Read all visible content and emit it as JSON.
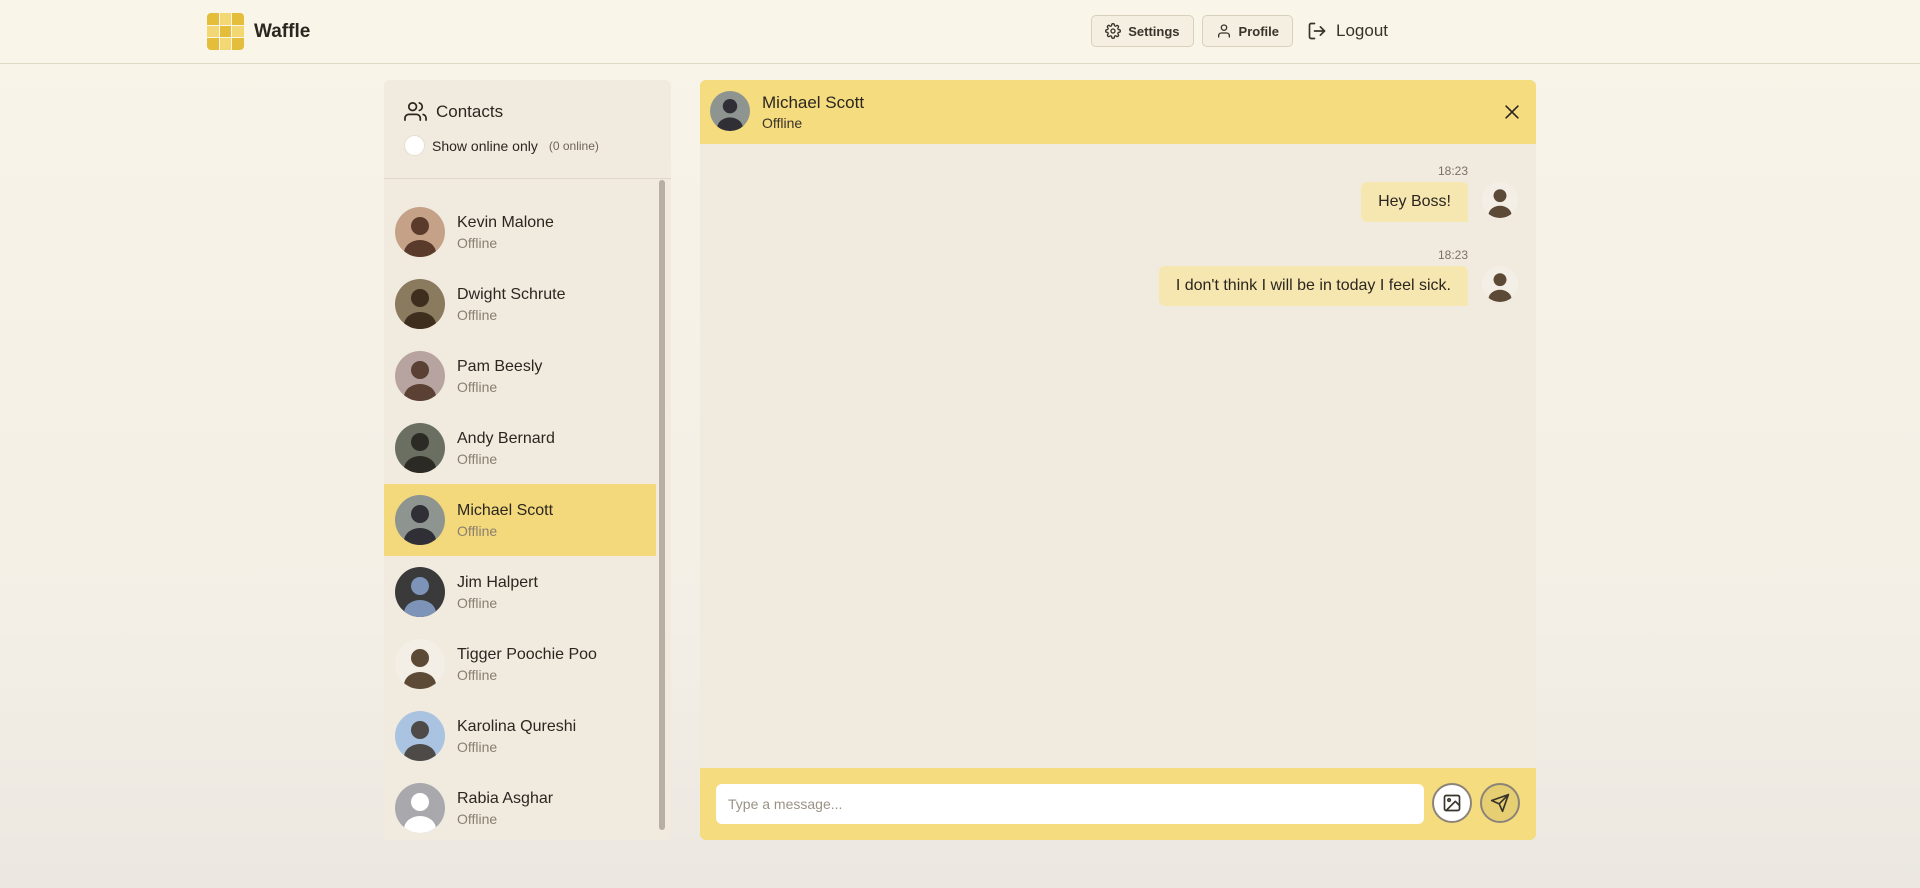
{
  "app": {
    "name": "Waffle"
  },
  "header": {
    "settings_label": "Settings",
    "profile_label": "Profile",
    "logout_label": "Logout"
  },
  "colors": {
    "accent": "#f4dc7f",
    "active_contact": "#f3d97c",
    "panel_bg": "#f1ebdf",
    "bubble": "#f6e7b1",
    "logo_dark": "#e4bd3a",
    "logo_light": "#f2d773"
  },
  "icons": {
    "settings": "gear-icon",
    "profile": "user-icon",
    "logout": "logout-icon",
    "contacts": "users-icon",
    "close": "close-icon",
    "image": "image-icon",
    "send": "send-icon"
  },
  "contacts": {
    "title": "Contacts",
    "filter_label": "Show online only",
    "online_count": "(0 online)",
    "items": [
      {
        "name": "Kevin Malone",
        "status": "Offline",
        "active": false,
        "avatar": {
          "bg": "#c5a287",
          "fg": "#5a3a2a"
        }
      },
      {
        "name": "Dwight Schrute",
        "status": "Offline",
        "active": false,
        "avatar": {
          "bg": "#8a7a5e",
          "fg": "#3e2e1e"
        }
      },
      {
        "name": "Pam Beesly",
        "status": "Offline",
        "active": false,
        "avatar": {
          "bg": "#b7a4a0",
          "fg": "#5b4034"
        }
      },
      {
        "name": "Andy Bernard",
        "status": "Offline",
        "active": false,
        "avatar": {
          "bg": "#6a6f62",
          "fg": "#2c2a24"
        }
      },
      {
        "name": "Michael Scott",
        "status": "Offline",
        "active": true,
        "avatar": {
          "bg": "#8e948f",
          "fg": "#2f2f35"
        }
      },
      {
        "name": "Jim Halpert",
        "status": "Offline",
        "active": false,
        "avatar": {
          "bg": "#3a3a3a",
          "fg": "#7d93b8"
        }
      },
      {
        "name": "Tigger Poochie Poo",
        "status": "Offline",
        "active": false,
        "avatar": {
          "bg": "#f4efe6",
          "fg": "#5c4a36"
        }
      },
      {
        "name": "Karolina Qureshi",
        "status": "Offline",
        "active": false,
        "avatar": {
          "bg": "#a9c3e0",
          "fg": "#4d4a48"
        }
      },
      {
        "name": "Rabia Asghar",
        "status": "Offline",
        "active": false,
        "avatar": {
          "bg": "#a8a8ad",
          "fg": "#ffffff"
        }
      }
    ]
  },
  "chat": {
    "contact_name": "Michael Scott",
    "contact_status": "Offline",
    "messages": [
      {
        "time": "18:23",
        "text": "Hey Boss!"
      },
      {
        "time": "18:23",
        "text": "I don't think I will be in today I feel sick."
      }
    ],
    "input_placeholder": "Type a message..."
  }
}
